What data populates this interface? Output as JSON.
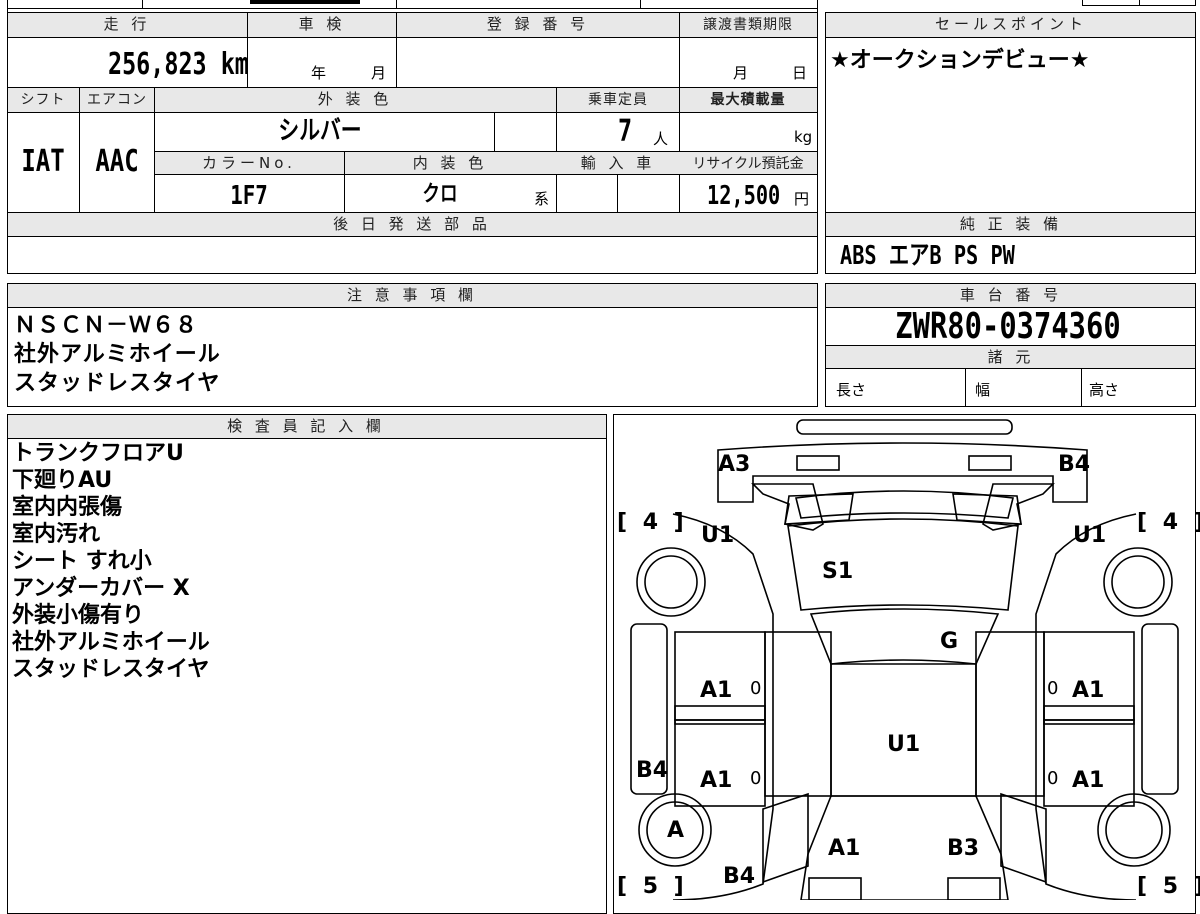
{
  "header": {
    "mileage_label": "走 行",
    "shaken_label": "車 検",
    "reg_label": "登 録 番 号",
    "transfer_label": "譲渡書類期限",
    "sales_label": "セールスポイント"
  },
  "values": {
    "mileage": "256,823 km",
    "year_unit": "年",
    "month_unit": "月",
    "transfer_month": "月",
    "transfer_day": "日",
    "sales_point": "★オークションデビュー★"
  },
  "row2": {
    "shift_label": "シフト",
    "aircon_label": "エアコン",
    "exterior_label": "外 装 色",
    "capacity_label": "乗車定員",
    "maxload_label": "最大積載量",
    "shift": "IAT",
    "aircon": "AAC",
    "exterior_color": "シルバー",
    "capacity": "7",
    "capacity_unit": "人",
    "maxload_unit": "kg",
    "colorno_label": "カラーNo.",
    "interior_label": "内 装 色",
    "import_label": "輸 入 車",
    "recycle_label": "リサイクル預託金",
    "color_no": "1F7",
    "interior_color": "クロ",
    "interior_suffix": "系",
    "recycle_fee": "12,500",
    "recycle_unit": "円"
  },
  "parts": {
    "later_label": "後 日 発 送 部 品",
    "equip_label": "純 正 装 備",
    "equipment": "ABS エアB PS PW"
  },
  "notes": {
    "label": "注 意 事 項 欄",
    "lines": [
      "ＮＳＣＮ－Ｗ６８",
      "社外アルミホイール",
      "スタッドレスタイヤ"
    ]
  },
  "chassis": {
    "label": "車 台 番 号",
    "number": "ZWR80-0374360",
    "specs_label": "諸 元",
    "length": "長さ",
    "width": "幅",
    "height": "高さ"
  },
  "inspector": {
    "label": "検 査 員 記 入 欄",
    "lines": [
      "トランクフロアU",
      "下廻りAU",
      "室内内張傷",
      "室内汚れ",
      "シート すれ小",
      "アンダーカバー X",
      "外装小傷有り",
      "社外アルミホイール",
      "スタッドレスタイヤ"
    ]
  },
  "diagram": {
    "a3": "A3",
    "b4_top": "B4",
    "tire_fl": "[ 4 ]",
    "tire_fr": "[ 4 ]",
    "u1_left": "U1",
    "u1_right": "U1",
    "s1": "S1",
    "g": "G",
    "a1_l1": "A1",
    "a1_r1": "A1",
    "zero_l1": "0",
    "zero_r1": "0",
    "u1_roof": "U1",
    "b4_side": "B4",
    "a1_l2": "A1",
    "a1_r2": "A1",
    "zero_l2": "0",
    "zero_r2": "0",
    "a_wheel": "A",
    "a1_rear": "A1",
    "b3_rear": "B3",
    "b4_bottom": "B4",
    "tire_rl": "[ 5 ]",
    "tire_rr": "[ 5 ]"
  }
}
